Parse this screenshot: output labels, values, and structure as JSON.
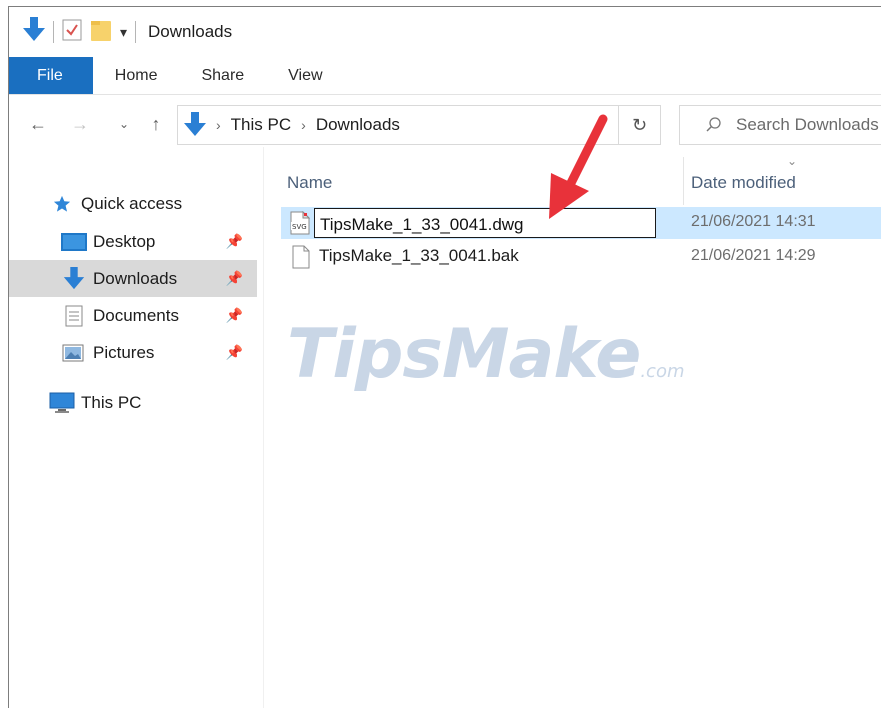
{
  "window": {
    "title": "Downloads"
  },
  "ribbon": {
    "tabs": [
      "File",
      "Home",
      "Share",
      "View"
    ]
  },
  "address": {
    "crumbs": [
      "This PC",
      "Downloads"
    ]
  },
  "search": {
    "placeholder": "Search Downloads"
  },
  "sidebar": {
    "items": [
      {
        "label": "Quick access",
        "icon": "star-icon"
      },
      {
        "label": "Desktop",
        "icon": "desktop-folder-icon",
        "pinned": true
      },
      {
        "label": "Downloads",
        "icon": "download-arrow-icon",
        "pinned": true,
        "selected": true
      },
      {
        "label": "Documents",
        "icon": "documents-icon",
        "pinned": true
      },
      {
        "label": "Pictures",
        "icon": "pictures-icon",
        "pinned": true
      },
      {
        "label": "This PC",
        "icon": "computer-icon"
      }
    ]
  },
  "columns": {
    "name": "Name",
    "date": "Date modified"
  },
  "files": [
    {
      "name": "TipsMake_1_33_0041.dwg",
      "date": "21/06/2021 14:31",
      "editing": true,
      "icon": "svg-file-icon"
    },
    {
      "name": "TipsMake_1_33_0041.bak",
      "date": "21/06/2021 14:29",
      "icon": "blank-file-icon"
    }
  ],
  "watermark": {
    "brand": "TipsMake",
    "suffix": ".com"
  },
  "colors": {
    "accent": "#1a6fc0",
    "selection": "#cce8ff",
    "annotation_arrow": "#e8323a"
  }
}
